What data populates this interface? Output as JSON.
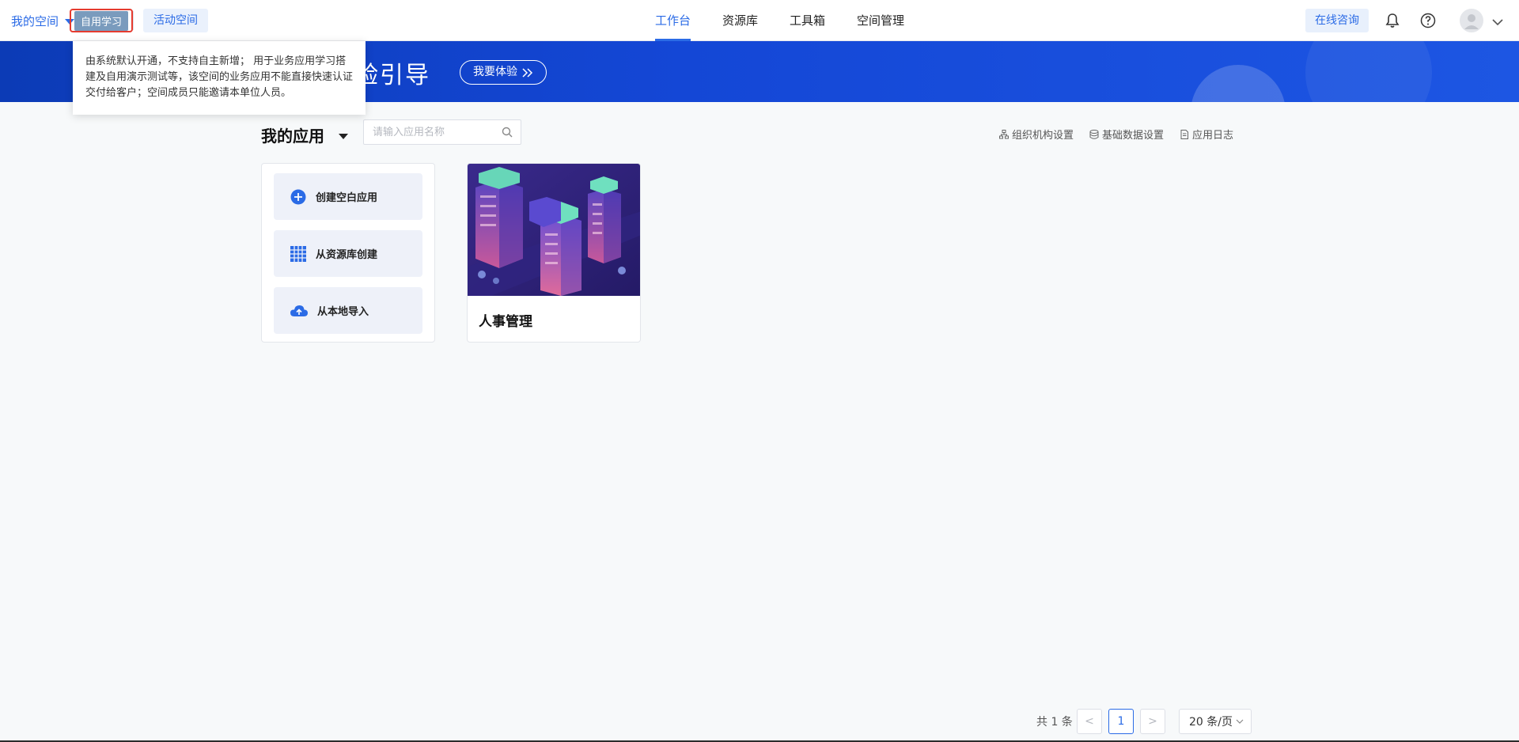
{
  "topbar": {
    "space_name": "我的空间",
    "space_tag": "自用学习",
    "activity_space": "活动空间",
    "nav": [
      "工作台",
      "资源库",
      "工具箱",
      "空间管理"
    ],
    "active_nav_index": 0,
    "consult_label": "在线咨询",
    "icons": [
      "bell-icon",
      "help-icon",
      "avatar-icon",
      "chevron-down-icon"
    ]
  },
  "banner": {
    "title": "验引导",
    "button_label": "我要体验"
  },
  "tooltip": {
    "text": "由系统默认开通，不支持自主新增； 用于业务应用学习搭建及自用演示测试等，该空间的业务应用不能直接快速认证交付给客户；空间成员只能邀请本单位人员。"
  },
  "apps_section": {
    "title": "我的应用",
    "search_placeholder": "请输入应用名称",
    "tools": [
      "组织机构设置",
      "基础数据设置",
      "应用日志"
    ],
    "create_options": [
      {
        "label": "创建空白应用",
        "icon": "plus-circle-icon"
      },
      {
        "label": "从资源库创建",
        "icon": "grid-icon"
      },
      {
        "label": "从本地导入",
        "icon": "cloud-upload-icon"
      }
    ],
    "apps": [
      {
        "name": "人事管理"
      }
    ]
  },
  "pagination": {
    "total_text": "共 1 条",
    "current_page": "1",
    "prev": "<",
    "next": ">",
    "page_size": "20 条/页"
  },
  "colors": {
    "primary": "#2b6be6",
    "banner": "#1447d6",
    "highlight_red": "#e53b2f"
  }
}
